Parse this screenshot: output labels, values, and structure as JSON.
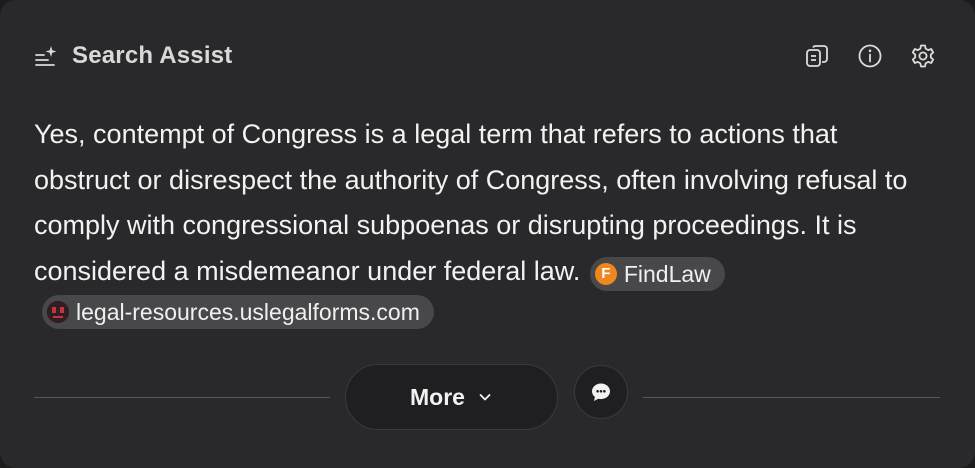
{
  "header": {
    "title": "Search Assist",
    "icons": {
      "title": "sparkle-list-icon",
      "copy": "copy-icon",
      "info": "info-icon",
      "settings": "gear-icon"
    }
  },
  "answer": {
    "text": "Yes, contempt of Congress is a legal term that refers to actions that obstruct or disrespect the authority of Congress, often involving refusal to comply with congressional subpoenas or disrupting proceedings. It is considered a misdemeanor under federal law.",
    "sources": [
      {
        "label": "FindLaw",
        "icon_letter": "F",
        "icon_color": "#f0861e"
      },
      {
        "label": "legal-resources.uslegalforms.com",
        "icon_color": "#2f1e24"
      }
    ]
  },
  "footer": {
    "more_label": "More",
    "more_icon": "chevron-down-icon",
    "chat_icon": "chat-bubble-icon"
  },
  "colors": {
    "card_background": "#29292b",
    "chip_background": "#48484b",
    "button_background": "#1f1f21"
  }
}
